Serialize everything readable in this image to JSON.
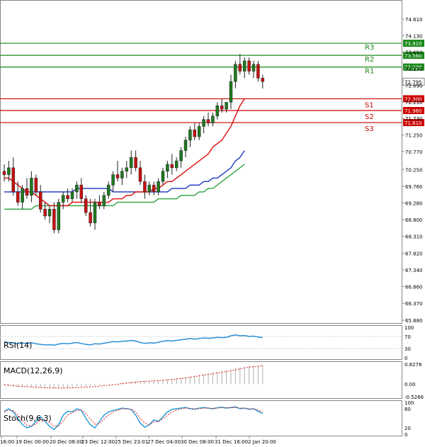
{
  "chart_data": {
    "type": "candlestick",
    "price_axis": {
      "ylim": [
        65.88,
        75.0
      ],
      "ticks": [
        "74.610",
        "74.130",
        "73.650",
        "73.170",
        "72.690",
        "72.210",
        "71.730",
        "71.250",
        "70.770",
        "70.250",
        "69.760",
        "69.280",
        "68.800",
        "68.310",
        "67.820",
        "67.340",
        "66.860",
        "66.370",
        "65.880"
      ],
      "current_price": "72.795"
    },
    "levels": [
      {
        "name": "R3",
        "value": "73.910",
        "color": "#1a8a1a"
      },
      {
        "name": "R2",
        "value": "73.560",
        "color": "#1a8a1a"
      },
      {
        "name": "R1",
        "value": "73.220",
        "color": "#1a8a1a"
      },
      {
        "name": "S1",
        "value": "72.300",
        "color": "#cc0000"
      },
      {
        "name": "S2",
        "value": "71.960",
        "color": "#cc0000"
      },
      {
        "name": "S3",
        "value": "71.610",
        "color": "#cc0000"
      }
    ],
    "x_labels": [
      "16:00",
      "19 Dec 00:00",
      "20 Dec 08:00",
      "23 Dec 12:00",
      "25 Dec 23:01",
      "27 Dec 04:00",
      "30 Dec 08:00",
      "31 Dec 16:00",
      "2 Jan 20:00"
    ],
    "candles": [
      [
        70.2,
        70.4,
        69.9,
        70.1
      ],
      [
        70.1,
        70.5,
        69.9,
        70.3
      ],
      [
        70.3,
        70.6,
        69.5,
        69.6
      ],
      [
        69.6,
        69.9,
        69.2,
        69.3
      ],
      [
        69.3,
        69.8,
        69.1,
        69.7
      ],
      [
        69.7,
        70.0,
        69.4,
        69.5
      ],
      [
        69.5,
        70.2,
        69.3,
        70.0
      ],
      [
        70.0,
        70.1,
        69.5,
        69.6
      ],
      [
        69.6,
        69.8,
        69.0,
        69.1
      ],
      [
        69.1,
        69.3,
        68.8,
        68.9
      ],
      [
        68.9,
        69.2,
        68.7,
        69.1
      ],
      [
        69.1,
        69.3,
        68.4,
        68.5
      ],
      [
        68.5,
        69.4,
        68.4,
        69.3
      ],
      [
        69.3,
        69.6,
        69.1,
        69.5
      ],
      [
        69.5,
        69.7,
        69.3,
        69.4
      ],
      [
        69.4,
        69.7,
        69.3,
        69.6
      ],
      [
        69.6,
        69.9,
        69.4,
        69.8
      ],
      [
        69.8,
        70.0,
        69.3,
        69.4
      ],
      [
        69.4,
        69.5,
        68.9,
        69.0
      ],
      [
        69.0,
        69.4,
        68.6,
        68.7
      ],
      [
        68.7,
        69.4,
        68.5,
        69.3
      ],
      [
        69.3,
        69.5,
        69.1,
        69.2
      ],
      [
        69.2,
        69.6,
        69.1,
        69.5
      ],
      [
        69.5,
        69.9,
        69.4,
        69.8
      ],
      [
        69.8,
        70.2,
        69.6,
        70.1
      ],
      [
        70.1,
        70.5,
        69.9,
        70.0
      ],
      [
        70.0,
        70.3,
        69.8,
        70.2
      ],
      [
        70.2,
        70.5,
        70.0,
        70.3
      ],
      [
        70.3,
        70.8,
        70.1,
        70.6
      ],
      [
        70.6,
        70.8,
        70.2,
        70.3
      ],
      [
        70.3,
        70.5,
        69.8,
        69.9
      ],
      [
        69.9,
        70.1,
        69.4,
        69.6
      ],
      [
        69.6,
        69.9,
        69.5,
        69.8
      ],
      [
        69.8,
        69.9,
        69.5,
        69.6
      ],
      [
        69.6,
        70.0,
        69.5,
        69.9
      ],
      [
        69.9,
        70.3,
        69.8,
        70.2
      ],
      [
        70.2,
        70.5,
        70.0,
        70.4
      ],
      [
        70.4,
        70.7,
        70.1,
        70.3
      ],
      [
        70.3,
        70.6,
        70.2,
        70.5
      ],
      [
        70.5,
        70.9,
        70.3,
        70.8
      ],
      [
        70.8,
        71.2,
        70.6,
        71.1
      ],
      [
        71.1,
        71.5,
        70.9,
        71.4
      ],
      [
        71.4,
        71.6,
        71.1,
        71.2
      ],
      [
        71.2,
        71.6,
        71.1,
        71.5
      ],
      [
        71.5,
        71.8,
        71.3,
        71.7
      ],
      [
        71.7,
        71.9,
        71.5,
        71.6
      ],
      [
        71.6,
        71.9,
        71.5,
        71.8
      ],
      [
        71.8,
        72.2,
        71.7,
        72.1
      ],
      [
        72.1,
        72.3,
        71.9,
        72.0
      ],
      [
        72.0,
        72.2,
        71.9,
        72.2
      ],
      [
        72.2,
        73.0,
        72.0,
        72.8
      ],
      [
        72.8,
        73.4,
        72.6,
        73.3
      ],
      [
        73.3,
        73.6,
        73.0,
        73.1
      ],
      [
        73.1,
        73.5,
        72.9,
        73.4
      ],
      [
        73.4,
        73.5,
        73.0,
        73.1
      ],
      [
        73.1,
        73.4,
        72.9,
        73.3
      ],
      [
        73.3,
        73.4,
        72.8,
        72.9
      ],
      [
        72.9,
        73.0,
        72.6,
        72.8
      ]
    ],
    "ma_red": [
      70.0,
      70.0,
      69.9,
      69.8,
      69.7,
      69.6,
      69.6,
      69.5,
      69.4,
      69.3,
      69.2,
      69.2,
      69.2,
      69.2,
      69.2,
      69.3,
      69.3,
      69.3,
      69.3,
      69.3,
      69.3,
      69.3,
      69.3,
      69.3,
      69.4,
      69.4,
      69.4,
      69.5,
      69.5,
      69.6,
      69.6,
      69.6,
      69.6,
      69.7,
      69.7,
      69.8,
      69.9,
      69.9,
      70.0,
      70.1,
      70.2,
      70.3,
      70.4,
      70.5,
      70.6,
      70.7,
      70.9,
      71.0,
      71.1,
      71.3,
      71.5,
      71.8,
      72.1,
      72.3,
      null,
      null,
      null,
      null
    ],
    "ma_blue": [
      69.6,
      69.6,
      69.6,
      69.6,
      69.6,
      69.6,
      69.6,
      69.6,
      69.6,
      69.6,
      69.6,
      69.6,
      69.6,
      69.6,
      69.6,
      69.6,
      69.7,
      69.7,
      69.7,
      69.7,
      69.7,
      69.7,
      69.7,
      69.7,
      69.6,
      69.6,
      69.6,
      69.6,
      69.6,
      69.6,
      69.6,
      69.6,
      69.6,
      69.6,
      69.6,
      69.6,
      69.6,
      69.7,
      69.7,
      69.7,
      69.7,
      69.8,
      69.8,
      69.8,
      69.9,
      69.9,
      70.0,
      70.0,
      70.1,
      70.2,
      70.3,
      70.5,
      70.6,
      70.8,
      null,
      null,
      null,
      null
    ],
    "ma_green": [
      69.1,
      69.1,
      69.1,
      69.1,
      69.1,
      69.1,
      69.1,
      69.2,
      69.2,
      69.2,
      69.2,
      69.2,
      69.2,
      69.2,
      69.2,
      69.2,
      69.2,
      69.2,
      69.2,
      69.2,
      69.2,
      69.2,
      69.2,
      69.2,
      69.2,
      69.3,
      69.3,
      69.3,
      69.3,
      69.3,
      69.3,
      69.3,
      69.3,
      69.3,
      69.4,
      69.4,
      69.4,
      69.4,
      69.4,
      69.5,
      69.5,
      69.5,
      69.5,
      69.6,
      69.6,
      69.7,
      69.7,
      69.8,
      69.9,
      70.0,
      70.1,
      70.2,
      70.3,
      70.4,
      null,
      null,
      null,
      null
    ],
    "rsi": {
      "label": "RSI(14)",
      "ticks": [
        "100",
        "70",
        "30",
        "0"
      ],
      "values": [
        52,
        50,
        48,
        46,
        48,
        47,
        49,
        46,
        44,
        42,
        43,
        41,
        45,
        47,
        46,
        48,
        50,
        47,
        44,
        42,
        46,
        45,
        48,
        50,
        53,
        52,
        54,
        55,
        57,
        55,
        50,
        47,
        49,
        48,
        51,
        54,
        56,
        55,
        57,
        59,
        61,
        63,
        61,
        63,
        65,
        64,
        65,
        67,
        66,
        67,
        72,
        75,
        72,
        73,
        70,
        71,
        68,
        66
      ]
    },
    "macd": {
      "label": "MACD(12,26,9)",
      "ticks": [
        "0.8278",
        "0.00",
        "-0.5266"
      ],
      "hist": [
        -0.05,
        -0.08,
        -0.1,
        -0.12,
        -0.13,
        -0.14,
        -0.15,
        -0.16,
        -0.17,
        -0.18,
        -0.18,
        -0.19,
        -0.18,
        -0.17,
        -0.16,
        -0.15,
        -0.13,
        -0.12,
        -0.11,
        -0.1,
        -0.08,
        -0.06,
        -0.04,
        -0.02,
        0.0,
        0.03,
        0.06,
        0.08,
        0.1,
        0.12,
        0.13,
        0.14,
        0.15,
        0.16,
        0.17,
        0.19,
        0.21,
        0.23,
        0.25,
        0.27,
        0.3,
        0.33,
        0.36,
        0.39,
        0.42,
        0.45,
        0.48,
        0.51,
        0.54,
        0.57,
        0.61,
        0.66,
        0.7,
        0.73,
        0.75,
        0.77,
        0.78,
        0.8
      ],
      "signal": [
        -0.03,
        -0.05,
        -0.07,
        -0.09,
        -0.1,
        -0.11,
        -0.12,
        -0.13,
        -0.14,
        -0.15,
        -0.16,
        -0.16,
        -0.17,
        -0.17,
        -0.16,
        -0.16,
        -0.15,
        -0.14,
        -0.13,
        -0.12,
        -0.11,
        -0.09,
        -0.07,
        -0.05,
        -0.03,
        -0.01,
        0.02,
        0.04,
        0.06,
        0.08,
        0.1,
        0.11,
        0.12,
        0.13,
        0.14,
        0.15,
        0.17,
        0.19,
        0.21,
        0.23,
        0.25,
        0.28,
        0.31,
        0.34,
        0.37,
        0.4,
        0.43,
        0.46,
        0.49,
        0.52,
        0.55,
        0.59,
        0.63,
        0.67,
        0.7,
        0.72,
        0.74,
        0.76
      ]
    },
    "stoch": {
      "label": "Stoch(9,6,3)",
      "ticks": [
        "100",
        "80",
        "20",
        "0"
      ],
      "k": [
        72,
        80,
        70,
        50,
        30,
        20,
        25,
        40,
        55,
        40,
        25,
        15,
        30,
        60,
        72,
        70,
        80,
        75,
        50,
        30,
        20,
        40,
        60,
        70,
        75,
        78,
        82,
        80,
        78,
        60,
        35,
        22,
        30,
        45,
        40,
        55,
        70,
        78,
        80,
        82,
        84,
        80,
        78,
        82,
        84,
        82,
        80,
        83,
        85,
        82,
        84,
        86,
        80,
        82,
        78,
        80,
        72,
        65
      ],
      "d": [
        70,
        75,
        74,
        60,
        42,
        28,
        26,
        32,
        46,
        45,
        36,
        25,
        26,
        42,
        60,
        68,
        74,
        76,
        65,
        48,
        32,
        33,
        48,
        60,
        70,
        75,
        80,
        80,
        78,
        70,
        50,
        35,
        30,
        38,
        40,
        48,
        60,
        70,
        76,
        80,
        82,
        81,
        80,
        80,
        82,
        82,
        81,
        82,
        83,
        83,
        83,
        84,
        82,
        82,
        80,
        80,
        76,
        70
      ]
    }
  }
}
